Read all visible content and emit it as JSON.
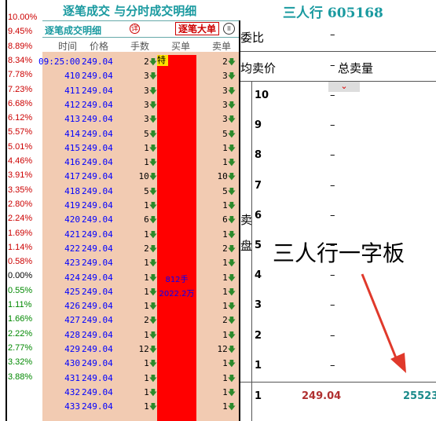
{
  "header": {
    "left_title": "逐笔成交 与分时成交明细",
    "right_title": "三人行 605168"
  },
  "scale": {
    "labels": [
      "10.00%",
      "9.45%",
      "8.89%",
      "8.34%",
      "7.78%",
      "7.23%",
      "6.68%",
      "6.12%",
      "5.57%",
      "5.01%",
      "4.46%",
      "3.91%",
      "3.35%",
      "2.80%",
      "2.24%",
      "1.69%",
      "1.14%",
      "0.58%",
      "0.00%",
      "0.55%",
      "1.11%",
      "1.66%",
      "2.22%",
      "2.77%",
      "3.32%",
      "3.88%"
    ],
    "colors": {
      "up": "#cc0000",
      "zero": "#000000",
      "down": "#008800"
    }
  },
  "detail": {
    "title": "逐笔成交明细",
    "info_icon": "详",
    "big_order_button": "逐笔大单",
    "pause_icon": "II",
    "columns": [
      "时间",
      "价格",
      "手数",
      "买单",
      "卖单"
    ],
    "special_mark": "特",
    "annotations": [
      {
        "text": "812手"
      },
      {
        "text": "2022.2万"
      }
    ],
    "rows": [
      {
        "time": "09:25:00",
        "price": "249.04",
        "qty": "2",
        "sell": "2"
      },
      {
        "time": "410",
        "price": "249.04",
        "qty": "3",
        "sell": "3"
      },
      {
        "time": "411",
        "price": "249.04",
        "qty": "3",
        "sell": "3"
      },
      {
        "time": "412",
        "price": "249.04",
        "qty": "3",
        "sell": "3"
      },
      {
        "time": "413",
        "price": "249.04",
        "qty": "3",
        "sell": "3"
      },
      {
        "time": "414",
        "price": "249.04",
        "qty": "5",
        "sell": "5"
      },
      {
        "time": "415",
        "price": "249.04",
        "qty": "1",
        "sell": "1"
      },
      {
        "time": "416",
        "price": "249.04",
        "qty": "1",
        "sell": "1"
      },
      {
        "time": "417",
        "price": "249.04",
        "qty": "10",
        "sell": "10"
      },
      {
        "time": "418",
        "price": "249.04",
        "qty": "5",
        "sell": "5"
      },
      {
        "time": "419",
        "price": "249.04",
        "qty": "1",
        "sell": "1"
      },
      {
        "time": "420",
        "price": "249.04",
        "qty": "6",
        "sell": "6"
      },
      {
        "time": "421",
        "price": "249.04",
        "qty": "1",
        "sell": "1"
      },
      {
        "time": "422",
        "price": "249.04",
        "qty": "2",
        "sell": "2"
      },
      {
        "time": "423",
        "price": "249.04",
        "qty": "1",
        "sell": "1"
      },
      {
        "time": "424",
        "price": "249.04",
        "qty": "1",
        "sell": "1"
      },
      {
        "time": "425",
        "price": "249.04",
        "qty": "1",
        "sell": "1"
      },
      {
        "time": "426",
        "price": "249.04",
        "qty": "1",
        "sell": "1"
      },
      {
        "time": "427",
        "price": "249.04",
        "qty": "2",
        "sell": "2"
      },
      {
        "time": "428",
        "price": "249.04",
        "qty": "1",
        "sell": "1"
      },
      {
        "time": "429",
        "price": "249.04",
        "qty": "12",
        "sell": "12"
      },
      {
        "time": "430",
        "price": "249.04",
        "qty": "1",
        "sell": "1"
      },
      {
        "time": "431",
        "price": "249.04",
        "qty": "1",
        "sell": "1"
      },
      {
        "time": "432",
        "price": "249.04",
        "qty": "1",
        "sell": "1"
      },
      {
        "time": "433",
        "price": "249.04",
        "qty": "1",
        "sell": "1"
      }
    ]
  },
  "right": {
    "weibi_label": "委比",
    "weibi_value": "–",
    "avg_sell_label": "均卖价",
    "avg_sell_value": "–",
    "total_sell_label": "总卖量",
    "sell_side_label_1": "卖",
    "sell_side_label_2": "盘",
    "levels": [
      "10",
      "9",
      "8",
      "7",
      "6",
      "5",
      "4",
      "3",
      "2",
      "1"
    ],
    "level_value": "–",
    "bottom": {
      "level": "1",
      "price": "249.04",
      "volume": "25523"
    }
  },
  "overlay_text": "三人行一字板"
}
